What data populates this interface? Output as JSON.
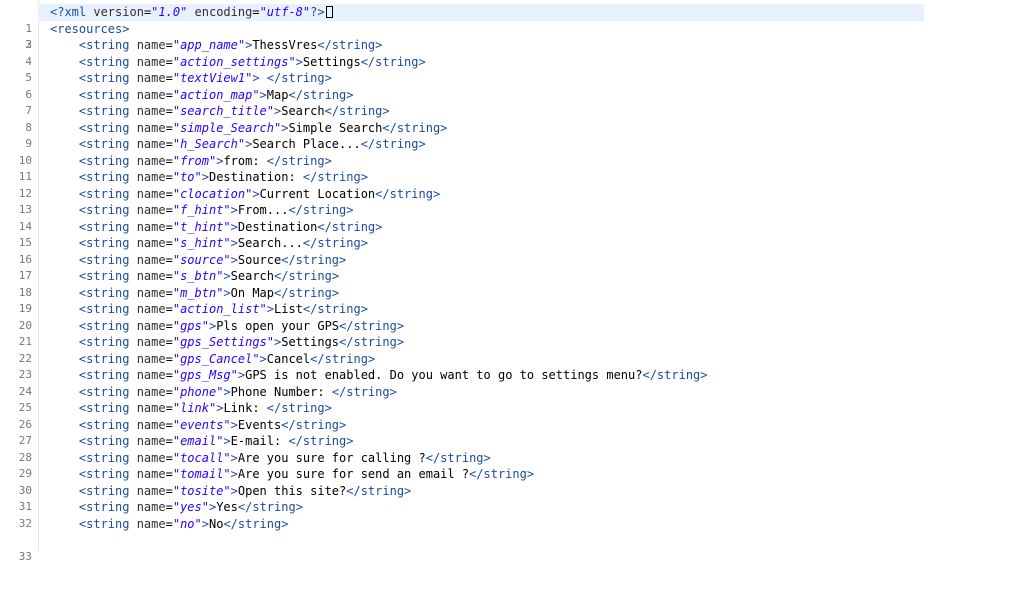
{
  "editor": {
    "xml_decl": {
      "open": "<?xml ",
      "version_attr": "version",
      "version_val": "\"1.0\"",
      "encoding_attr": "encoding",
      "encoding_val": "\"utf-8\"",
      "close": "?>"
    },
    "resources_open": "<resources>",
    "tag_open": "<string ",
    "name_attr": "name",
    "tag_close_open": ">",
    "tag_end": "</string>",
    "strings": [
      {
        "name": "\"app_name\"",
        "value": "ThessVres"
      },
      {
        "name": "\"action_settings\"",
        "value": "Settings"
      },
      {
        "name": "\"textView1\"",
        "value": " "
      },
      {
        "name": "\"action_map\"",
        "value": "Map"
      },
      {
        "name": "\"search_title\"",
        "value": "Search"
      },
      {
        "name": "\"simple_Search\"",
        "value": "Simple Search"
      },
      {
        "name": "\"h_Search\"",
        "value": "Search Place..."
      },
      {
        "name": "\"from\"",
        "value": "from: "
      },
      {
        "name": "\"to\"",
        "value": "Destination: "
      },
      {
        "name": "\"clocation\"",
        "value": "Current Location"
      },
      {
        "name": "\"f_hint\"",
        "value": "From..."
      },
      {
        "name": "\"t_hint\"",
        "value": "Destination"
      },
      {
        "name": "\"s_hint\"",
        "value": "Search..."
      },
      {
        "name": "\"source\"",
        "value": "Source"
      },
      {
        "name": "\"s_btn\"",
        "value": "Search"
      },
      {
        "name": "\"m_btn\"",
        "value": "On Map"
      },
      {
        "name": "\"action_list\"",
        "value": "List"
      },
      {
        "name": "\"gps\"",
        "value": "Pls open your GPS"
      },
      {
        "name": "\"gps_Settings\"",
        "value": "Settings"
      },
      {
        "name": "\"gps_Cancel\"",
        "value": "Cancel"
      },
      {
        "name": "\"gps_Msg\"",
        "value": "GPS is not enabled. Do you want to go to settings menu?"
      },
      {
        "name": "\"phone\"",
        "value": "Phone Number: "
      },
      {
        "name": "\"link\"",
        "value": "Link: "
      },
      {
        "name": "\"events\"",
        "value": "Events"
      },
      {
        "name": "\"email\"",
        "value": "E-mail: "
      },
      {
        "name": "\"tocall\"",
        "value": "Are you sure for calling ?"
      },
      {
        "name": "\"tomail\"",
        "value": "Are you sure for send an email ?"
      },
      {
        "name": "\"tosite\"",
        "value": "Open this site?"
      },
      {
        "name": "\"yes\"",
        "value": "Yes"
      },
      {
        "name": "\"no\"",
        "value": "No"
      }
    ],
    "line_numbers": [
      "1",
      "2",
      "3",
      "4",
      "5",
      "6",
      "7",
      "8",
      "9",
      "10",
      "11",
      "12",
      "13",
      "14",
      "15",
      "16",
      "17",
      "18",
      "19",
      "20",
      "21",
      "22",
      "23",
      "24",
      "25",
      "26",
      "27",
      "28",
      "29",
      "30",
      "31",
      "32",
      "33"
    ]
  }
}
